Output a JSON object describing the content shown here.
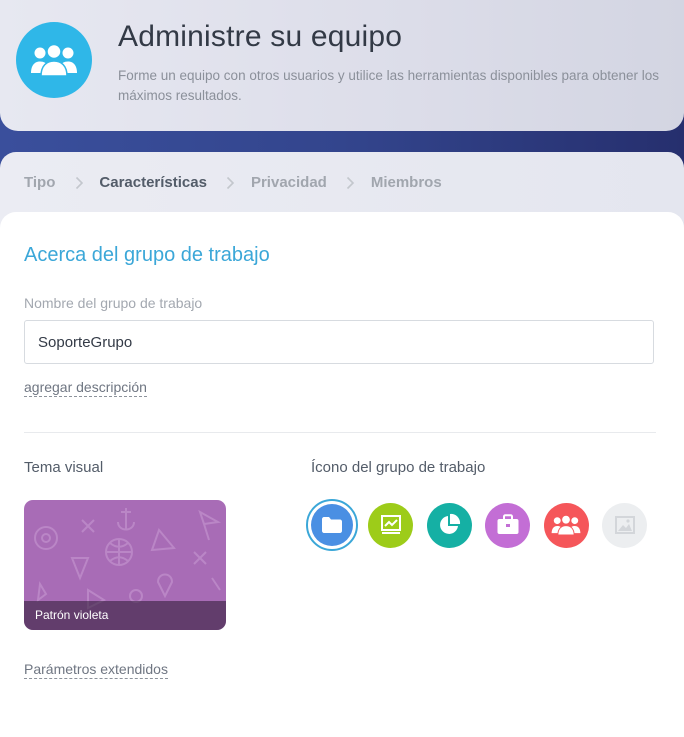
{
  "header": {
    "title": "Administre su equipo",
    "subtitle": "Forme un equipo con otros usuarios y utilice las herramientas disponibles para obtener los máximos resultados.",
    "avatar_icon": "users-group-icon",
    "avatar_color": "#2fb7e8"
  },
  "breadcrumb": {
    "steps": [
      {
        "label": "Tipo",
        "active": false
      },
      {
        "label": "Características",
        "active": true
      },
      {
        "label": "Privacidad",
        "active": false
      },
      {
        "label": "Miembros",
        "active": false
      }
    ]
  },
  "form": {
    "section_title": "Acerca del grupo de trabajo",
    "name_label": "Nombre del grupo de trabajo",
    "name_value": "SoporteGrupo",
    "add_description": "agregar descripción",
    "theme_label": "Tema visual",
    "theme_name": "Patrón violeta",
    "theme_color": "#a86cb6",
    "icon_label": "Ícono del grupo de trabajo",
    "icons": [
      {
        "name": "folder-icon",
        "color": "#4a8fe3",
        "selected": true
      },
      {
        "name": "presentation-chart-icon",
        "color": "#9dcc19",
        "selected": false
      },
      {
        "name": "pie-chart-icon",
        "color": "#15b0a4",
        "selected": false
      },
      {
        "name": "briefcase-icon",
        "color": "#c36ed5",
        "selected": false
      },
      {
        "name": "users-group-icon",
        "color": "#f5565a",
        "selected": false
      },
      {
        "name": "image-placeholder-icon",
        "color": "#eceef0",
        "selected": false
      }
    ],
    "extended_params": "Parámetros extendidos",
    "accent_color": "#3ba7d8"
  }
}
